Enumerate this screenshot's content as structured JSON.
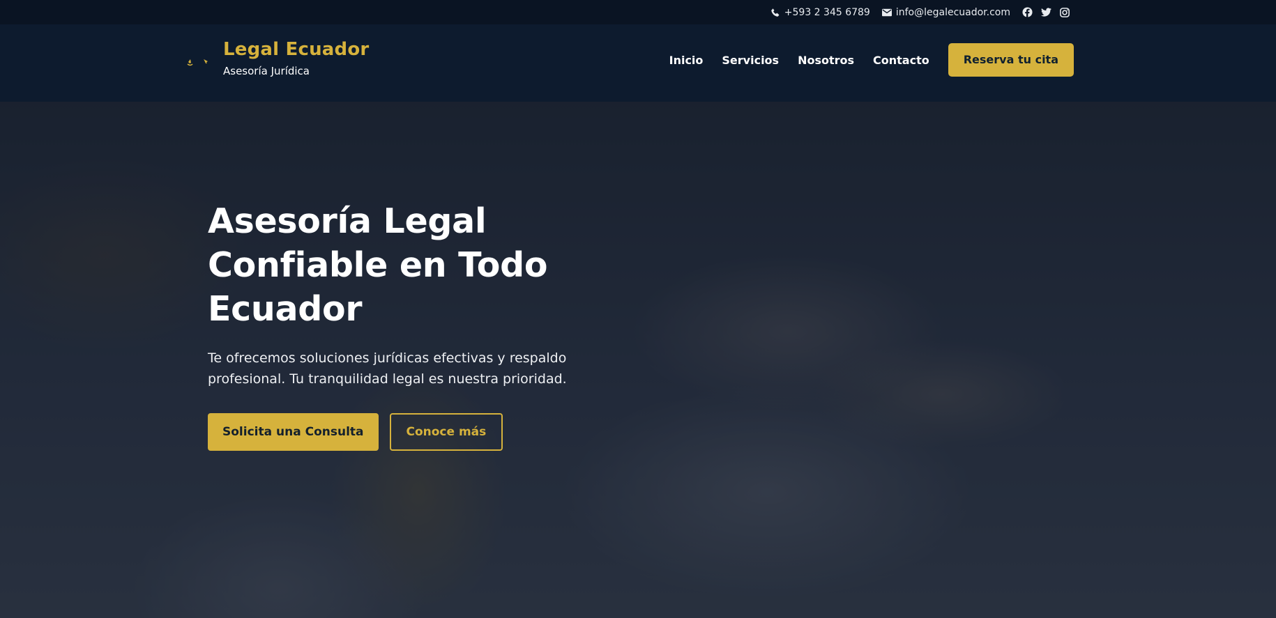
{
  "topbar": {
    "phone": "+593 2 345 6789",
    "email": "info@legalecuador.com",
    "icons": [
      "phone-icon",
      "envelope-icon",
      "facebook-icon",
      "twitter-icon",
      "instagram-icon"
    ]
  },
  "brand": {
    "name": "Legal Ecuador",
    "tagline": "Asesoría Jurídica"
  },
  "nav": {
    "items": [
      "Inicio",
      "Servicios",
      "Nosotros",
      "Contacto"
    ],
    "cta": "Reserva tu cita"
  },
  "hero": {
    "title": "Asesoría Legal Confiable en Todo Ecuador",
    "subtitle": "Te ofrecemos soluciones jurídicas efectivas y respaldo profesional. Tu tranquilidad legal es nuestra prioridad.",
    "primary_button": "Solicita una Consulta",
    "secondary_button": "Conoce más"
  },
  "colors": {
    "accent": "#d6b23c",
    "navy": "#0d1b2e",
    "topbar": "#0a1423"
  }
}
